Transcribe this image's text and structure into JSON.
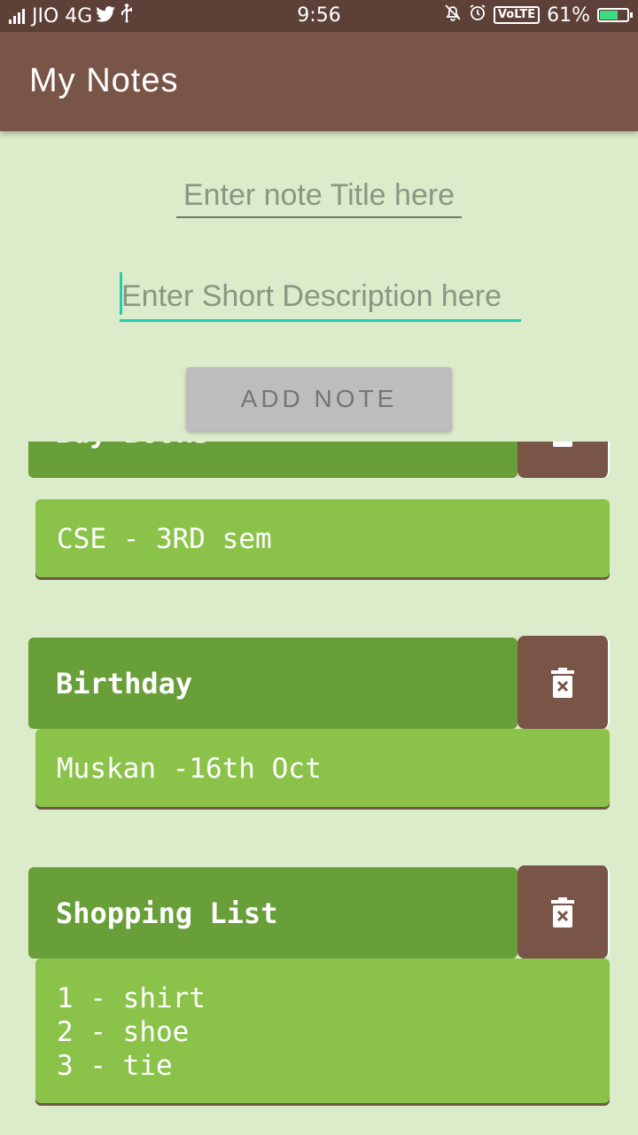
{
  "status_bar": {
    "carrier": "JIO 4G",
    "time": "9:56",
    "volte": "VoLTE",
    "battery": "61%",
    "battery_level": 0.61,
    "icons": [
      "signal-icon",
      "twitter-icon",
      "usb-icon",
      "mute-icon",
      "alarm-icon",
      "battery-icon"
    ]
  },
  "appbar": {
    "title": "My Notes"
  },
  "form": {
    "title_placeholder": "Enter note Title here",
    "title_value": "",
    "desc_placeholder": "Enter Short Description here",
    "desc_value": "",
    "add_label": "ADD NOTE"
  },
  "colors": {
    "appbar": "#795548",
    "background": "#dcebc9",
    "title_card": "#689f38",
    "desc_card": "#8bc34a",
    "accent": "#1fcfb0",
    "delete": "#795548"
  },
  "notes": [
    {
      "title": "Buy Books",
      "description": "CSE - 3RD sem"
    },
    {
      "title": "Birthday",
      "description": "Muskan -16th Oct"
    },
    {
      "title": "Shopping List",
      "description": "1 - shirt\n2 - shoe\n3 - tie"
    }
  ]
}
